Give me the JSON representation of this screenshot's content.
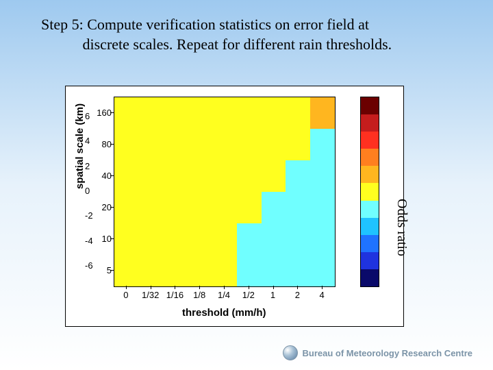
{
  "title_line1": "Step 5: Compute verification statistics on error field at",
  "title_line2": "discrete scales. Repeat for different rain thresholds.",
  "odds_label": "Odds ratio",
  "footer_text": "Bureau of Meteorology Research Centre",
  "chart_data": {
    "type": "heatmap",
    "xlabel": "threshold (mm/h)",
    "ylabel": "spatial scale (km)",
    "x_categories": [
      "0",
      "1/32",
      "1/16",
      "1/8",
      "1/4",
      "1/2",
      "1",
      "2",
      "4"
    ],
    "y_categories": [
      "5",
      "10",
      "20",
      "40",
      "80",
      "160"
    ],
    "colorbar_label": "Odds ratio",
    "colorbar_ticks": [
      "6",
      "4",
      "2",
      "0",
      "-2",
      "-4",
      "-6"
    ],
    "colorbar_colors": [
      "#6b0000",
      "#c51d1d",
      "#ff3020",
      "#ff7f1f",
      "#ffb61f",
      "#ffff1f",
      "#70ffff",
      "#1fc3ff",
      "#1f73ff",
      "#1f33df",
      "#0a0a6a"
    ],
    "cells": {
      "comment": "value encodes color index into colorbar_colors; rows listed bottom(y=5) to top(y=160)",
      "grid": [
        [
          5,
          5,
          5,
          5,
          5,
          6,
          6,
          6,
          6
        ],
        [
          5,
          5,
          5,
          5,
          5,
          6,
          6,
          6,
          6
        ],
        [
          5,
          5,
          5,
          5,
          5,
          5,
          6,
          6,
          6
        ],
        [
          5,
          5,
          5,
          5,
          5,
          5,
          5,
          6,
          6
        ],
        [
          5,
          5,
          5,
          5,
          5,
          5,
          5,
          5,
          6
        ],
        [
          5,
          5,
          5,
          5,
          5,
          5,
          5,
          5,
          4
        ]
      ]
    }
  }
}
